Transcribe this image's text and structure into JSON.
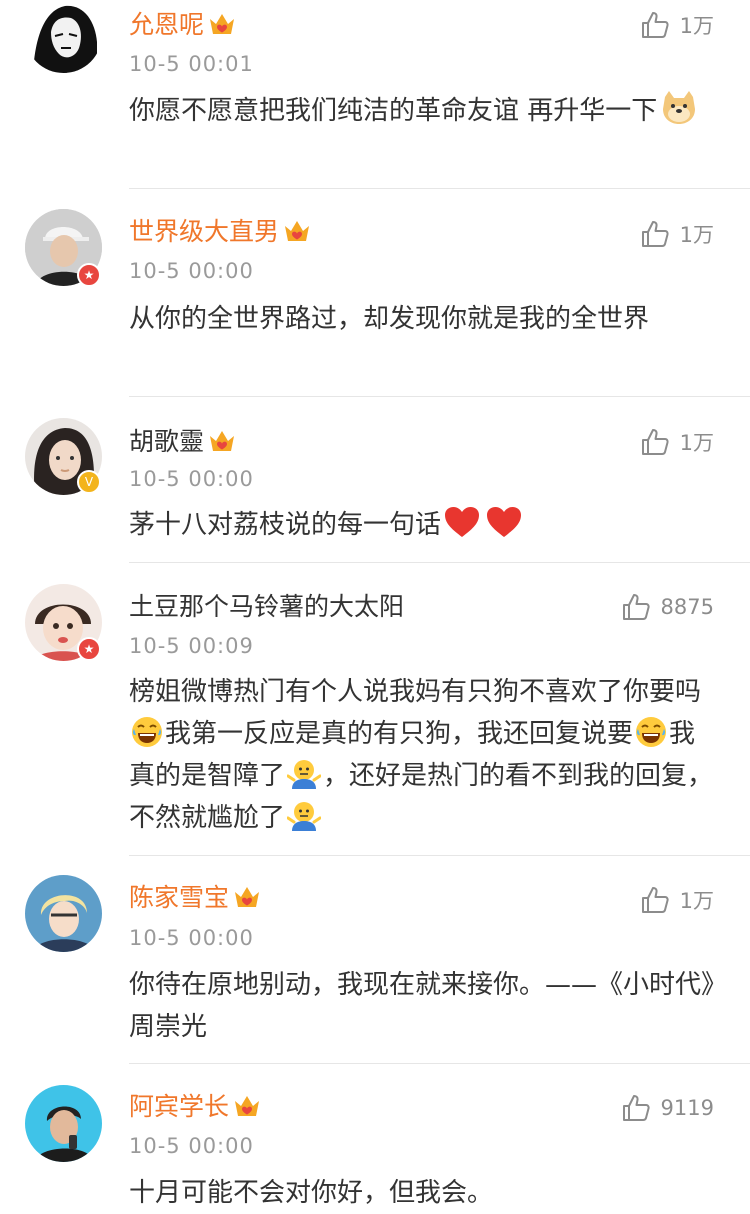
{
  "comments": [
    {
      "username": "允恩呢",
      "date": "10-5 00:01",
      "likes": "1万",
      "text_before": "你愿不愿意把我们纯洁的革命友谊 再升华一下",
      "avatar": "dark-sketch-portrait",
      "name_color": "#f0772b"
    },
    {
      "username": "世界级大直男",
      "date": "10-5 00:00",
      "likes": "1万",
      "text": "从你的全世界路过，却发现你就是我的全世界",
      "avatar": "man-in-cap-photo",
      "name_color": "#f0772b"
    },
    {
      "username": "胡歌靈",
      "date": "10-5 00:00",
      "likes": "1万",
      "text": "茅十八对荔枝说的每一句话",
      "avatar": "woman-portrait-photo",
      "name_color": "#333333"
    },
    {
      "username": "土豆那个马铃薯的大太阳",
      "date": "10-5 00:09",
      "likes": "8875",
      "text_parts": [
        "榜姐微博热门有个人说我妈有只狗不喜欢了你要吗",
        "我第一反应是真的有只狗，我还回复说要",
        "我真的是智障了",
        "，还好是热门的看不到我的回复，不然就尴尬了"
      ],
      "avatar": "baby-photo",
      "name_color": "#333333"
    },
    {
      "username": "陈家雪宝",
      "date": "10-5 00:00",
      "likes": "1万",
      "text": "你待在原地别动，我现在就来接你。——《小时代》周崇光",
      "avatar": "blond-man-photo",
      "name_color": "#f0772b"
    },
    {
      "username": "阿宾学长",
      "date": "10-5 00:00",
      "likes": "9119",
      "text": "十月可能不会对你好，但我会。",
      "avatar": "man-cyan-background-photo",
      "name_color": "#f0772b"
    }
  ],
  "icons": {
    "like": "thumbs-up-outline-icon",
    "crown": "vip-crown-icon",
    "verified_red": "star-badge-icon",
    "verified_gold": "v-badge-icon"
  },
  "colors": {
    "vip_name": "#f0772b",
    "normal_name": "#333333",
    "meta": "#9a9a9a",
    "heart": "#e8362f"
  }
}
